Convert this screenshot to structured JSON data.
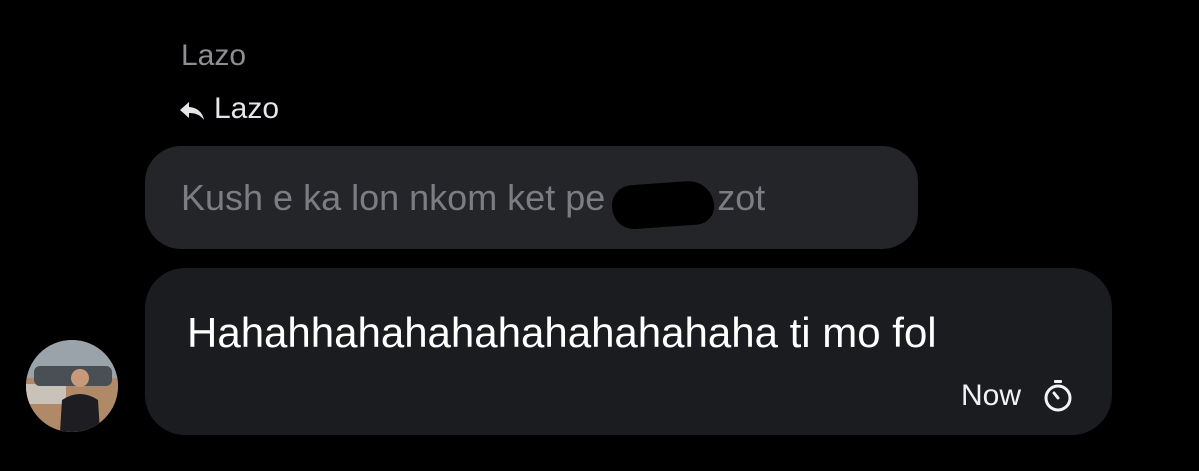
{
  "thread": {
    "sender_name": "Lazo",
    "reply_to_name": "Lazo",
    "quoted_message": "Kush e ka lon nkom ket pe     n mor zot",
    "message_text": "Hahahhahahahahahahahahaha ti mo fol",
    "timestamp": "Now"
  },
  "icons": {
    "reply": "reply-arrow-icon",
    "timer": "stopwatch-icon"
  },
  "colors": {
    "background": "#000000",
    "quoted_bubble": "#242529",
    "message_bubble": "#1b1c20",
    "secondary_text": "#8e8e93",
    "primary_text": "#ffffff"
  }
}
